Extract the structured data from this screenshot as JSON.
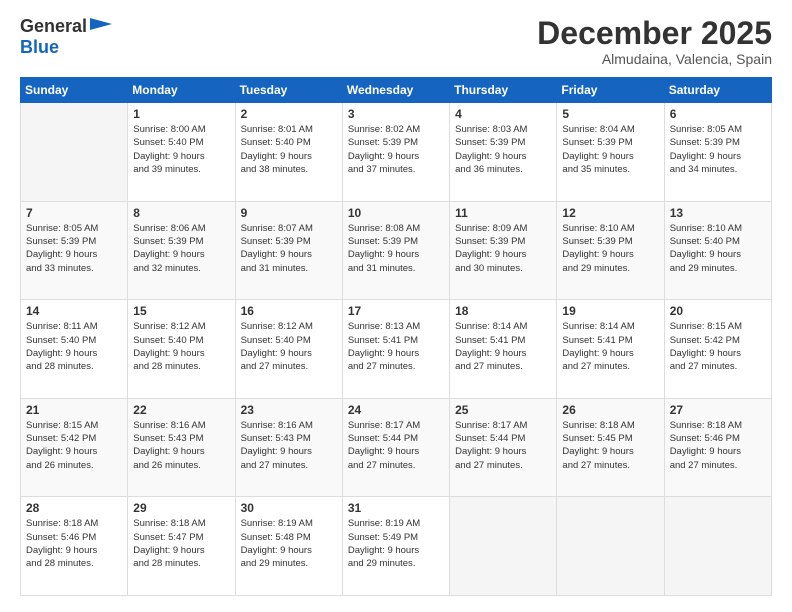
{
  "logo": {
    "general": "General",
    "blue": "Blue"
  },
  "title": "December 2025",
  "subtitle": "Almudaina, Valencia, Spain",
  "days_header": [
    "Sunday",
    "Monday",
    "Tuesday",
    "Wednesday",
    "Thursday",
    "Friday",
    "Saturday"
  ],
  "weeks": [
    [
      {
        "num": "",
        "info": ""
      },
      {
        "num": "1",
        "info": "Sunrise: 8:00 AM\nSunset: 5:40 PM\nDaylight: 9 hours\nand 39 minutes."
      },
      {
        "num": "2",
        "info": "Sunrise: 8:01 AM\nSunset: 5:40 PM\nDaylight: 9 hours\nand 38 minutes."
      },
      {
        "num": "3",
        "info": "Sunrise: 8:02 AM\nSunset: 5:39 PM\nDaylight: 9 hours\nand 37 minutes."
      },
      {
        "num": "4",
        "info": "Sunrise: 8:03 AM\nSunset: 5:39 PM\nDaylight: 9 hours\nand 36 minutes."
      },
      {
        "num": "5",
        "info": "Sunrise: 8:04 AM\nSunset: 5:39 PM\nDaylight: 9 hours\nand 35 minutes."
      },
      {
        "num": "6",
        "info": "Sunrise: 8:05 AM\nSunset: 5:39 PM\nDaylight: 9 hours\nand 34 minutes."
      }
    ],
    [
      {
        "num": "7",
        "info": "Sunrise: 8:05 AM\nSunset: 5:39 PM\nDaylight: 9 hours\nand 33 minutes."
      },
      {
        "num": "8",
        "info": "Sunrise: 8:06 AM\nSunset: 5:39 PM\nDaylight: 9 hours\nand 32 minutes."
      },
      {
        "num": "9",
        "info": "Sunrise: 8:07 AM\nSunset: 5:39 PM\nDaylight: 9 hours\nand 31 minutes."
      },
      {
        "num": "10",
        "info": "Sunrise: 8:08 AM\nSunset: 5:39 PM\nDaylight: 9 hours\nand 31 minutes."
      },
      {
        "num": "11",
        "info": "Sunrise: 8:09 AM\nSunset: 5:39 PM\nDaylight: 9 hours\nand 30 minutes."
      },
      {
        "num": "12",
        "info": "Sunrise: 8:10 AM\nSunset: 5:39 PM\nDaylight: 9 hours\nand 29 minutes."
      },
      {
        "num": "13",
        "info": "Sunrise: 8:10 AM\nSunset: 5:40 PM\nDaylight: 9 hours\nand 29 minutes."
      }
    ],
    [
      {
        "num": "14",
        "info": "Sunrise: 8:11 AM\nSunset: 5:40 PM\nDaylight: 9 hours\nand 28 minutes."
      },
      {
        "num": "15",
        "info": "Sunrise: 8:12 AM\nSunset: 5:40 PM\nDaylight: 9 hours\nand 28 minutes."
      },
      {
        "num": "16",
        "info": "Sunrise: 8:12 AM\nSunset: 5:40 PM\nDaylight: 9 hours\nand 27 minutes."
      },
      {
        "num": "17",
        "info": "Sunrise: 8:13 AM\nSunset: 5:41 PM\nDaylight: 9 hours\nand 27 minutes."
      },
      {
        "num": "18",
        "info": "Sunrise: 8:14 AM\nSunset: 5:41 PM\nDaylight: 9 hours\nand 27 minutes."
      },
      {
        "num": "19",
        "info": "Sunrise: 8:14 AM\nSunset: 5:41 PM\nDaylight: 9 hours\nand 27 minutes."
      },
      {
        "num": "20",
        "info": "Sunrise: 8:15 AM\nSunset: 5:42 PM\nDaylight: 9 hours\nand 27 minutes."
      }
    ],
    [
      {
        "num": "21",
        "info": "Sunrise: 8:15 AM\nSunset: 5:42 PM\nDaylight: 9 hours\nand 26 minutes."
      },
      {
        "num": "22",
        "info": "Sunrise: 8:16 AM\nSunset: 5:43 PM\nDaylight: 9 hours\nand 26 minutes."
      },
      {
        "num": "23",
        "info": "Sunrise: 8:16 AM\nSunset: 5:43 PM\nDaylight: 9 hours\nand 27 minutes."
      },
      {
        "num": "24",
        "info": "Sunrise: 8:17 AM\nSunset: 5:44 PM\nDaylight: 9 hours\nand 27 minutes."
      },
      {
        "num": "25",
        "info": "Sunrise: 8:17 AM\nSunset: 5:44 PM\nDaylight: 9 hours\nand 27 minutes."
      },
      {
        "num": "26",
        "info": "Sunrise: 8:18 AM\nSunset: 5:45 PM\nDaylight: 9 hours\nand 27 minutes."
      },
      {
        "num": "27",
        "info": "Sunrise: 8:18 AM\nSunset: 5:46 PM\nDaylight: 9 hours\nand 27 minutes."
      }
    ],
    [
      {
        "num": "28",
        "info": "Sunrise: 8:18 AM\nSunset: 5:46 PM\nDaylight: 9 hours\nand 28 minutes."
      },
      {
        "num": "29",
        "info": "Sunrise: 8:18 AM\nSunset: 5:47 PM\nDaylight: 9 hours\nand 28 minutes."
      },
      {
        "num": "30",
        "info": "Sunrise: 8:19 AM\nSunset: 5:48 PM\nDaylight: 9 hours\nand 29 minutes."
      },
      {
        "num": "31",
        "info": "Sunrise: 8:19 AM\nSunset: 5:49 PM\nDaylight: 9 hours\nand 29 minutes."
      },
      {
        "num": "",
        "info": ""
      },
      {
        "num": "",
        "info": ""
      },
      {
        "num": "",
        "info": ""
      }
    ]
  ]
}
